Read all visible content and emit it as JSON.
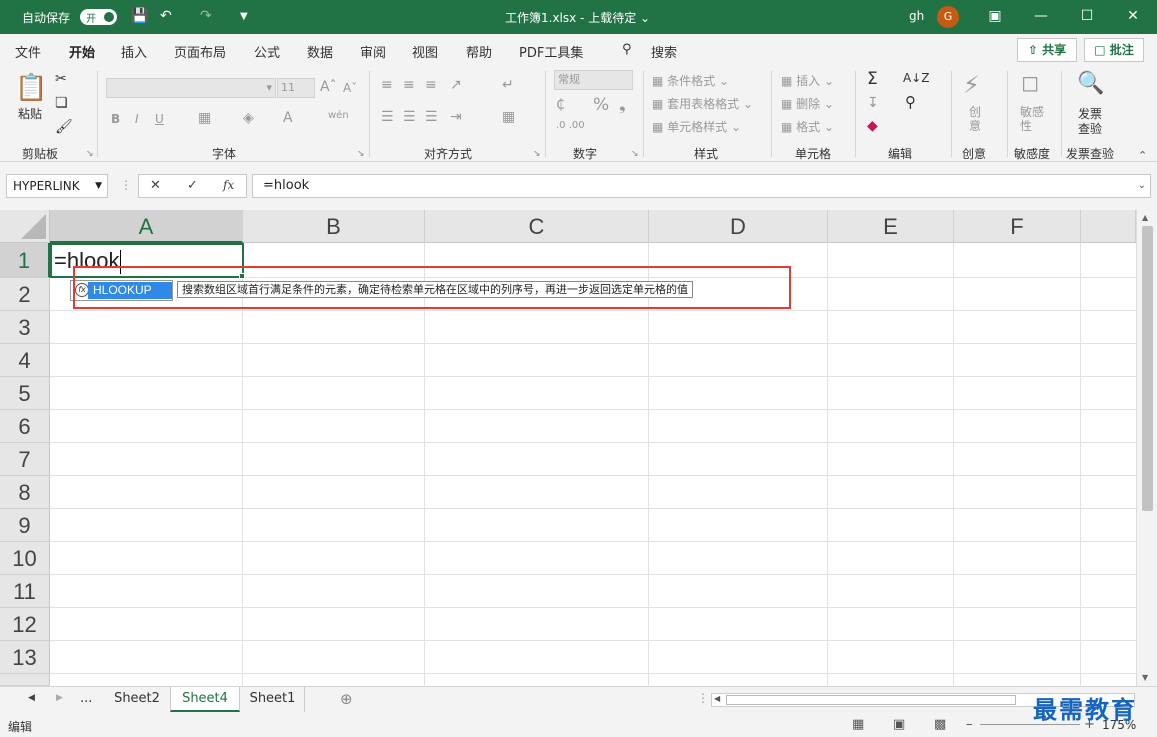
{
  "titlebar": {
    "autosave_label": "自动保存",
    "autosave_toggle": "开",
    "doc_title": "工作簿1.xlsx - 上载待定 ⌄",
    "user_name": "gh",
    "avatar_letter": "G"
  },
  "menu": {
    "tabs": [
      "文件",
      "开始",
      "插入",
      "页面布局",
      "公式",
      "数据",
      "审阅",
      "视图",
      "帮助",
      "PDF工具集"
    ],
    "search_label": "搜索",
    "share_label": "共享",
    "comment_label": "批注"
  },
  "ribbon": {
    "clipboard": {
      "paste": "粘贴",
      "label": "剪贴板"
    },
    "font": {
      "size": "11",
      "bold": "B",
      "italic": "I",
      "underline": "U",
      "label": "字体"
    },
    "alignment": {
      "label": "对齐方式"
    },
    "number": {
      "format": "常规",
      "percent": "%",
      "comma": "❟",
      "label": "数字"
    },
    "styles": {
      "conditional": "条件格式",
      "table": "套用表格格式",
      "cell": "单元格样式",
      "label": "样式"
    },
    "cells": {
      "insert": "插入",
      "delete": "删除",
      "format": "格式",
      "label": "单元格"
    },
    "editing": {
      "label": "编辑"
    },
    "creativity": {
      "button": "创意",
      "label": "创意"
    },
    "sensitivity": {
      "button": "敏感性",
      "label": "敏感度"
    },
    "invoice": {
      "button_line1": "发票",
      "button_line2": "查验",
      "label": "发票查验"
    }
  },
  "formula_bar": {
    "name_box": "HYPERLINK",
    "cancel": "✕",
    "enter": "✓",
    "fx": "fx",
    "formula": "=hlook"
  },
  "grid": {
    "columns": [
      "A",
      "B",
      "C",
      "D",
      "E",
      "F"
    ],
    "rows": [
      "1",
      "2",
      "3",
      "4",
      "5",
      "6",
      "7",
      "8",
      "9",
      "10",
      "11",
      "12",
      "13"
    ],
    "active_cell_text": "=hlook",
    "autocomplete": {
      "item": "HLOOKUP",
      "tooltip": "搜索数组区域首行满足条件的元素，确定待检索单元格在区域中的列序号，再进一步返回选定单元格的值"
    }
  },
  "sheets": {
    "more": "...",
    "tabs": [
      "Sheet2",
      "Sheet4",
      "Sheet1"
    ],
    "active": "Sheet4",
    "add": "⊕"
  },
  "status": {
    "mode": "编辑",
    "zoom": "175%",
    "watermark": "最需教育"
  },
  "colors": {
    "accent": "#217346",
    "highlight_box": "#e53935",
    "autocomplete_selected": "#2e8ae6"
  }
}
